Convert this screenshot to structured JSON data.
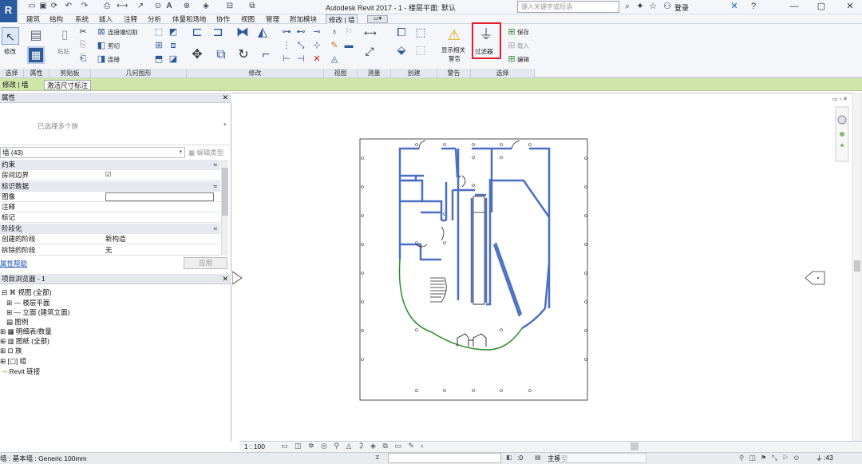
{
  "app": {
    "title": "Autodesk Revit 2017 -   1 - 楼层平面: 默认",
    "logo": "R",
    "search_placeholder": "键入关键字或短语",
    "login_label": "登录"
  },
  "tabs": [
    "建筑",
    "结构",
    "系统",
    "插入",
    "注释",
    "分析",
    "体量和场地",
    "协作",
    "视图",
    "管理",
    "附加模块",
    "修改 | 墙"
  ],
  "ribbon": {
    "modify_label": "修改",
    "paste_label": "粘贴",
    "connect_cut_label": "连接端切割",
    "cut_label": "剪切",
    "join_label": "连接",
    "display_warnings_label1": "显示相关",
    "display_warnings_label2": "警告",
    "filter_label": "过滤器",
    "save_label": "保存",
    "load_label": "载入",
    "edit_label": "编辑",
    "panels": [
      "选择",
      "属性",
      "剪贴板",
      "几何图形",
      "修改",
      "视图",
      "测量",
      "创建",
      "警告",
      "选择"
    ]
  },
  "context_bar": {
    "tab1": "修改 | 墙",
    "tab2": "激活尺寸标注"
  },
  "properties": {
    "title": "属性",
    "type_selector": "已选择多个族",
    "filter_label": "墙 (43)",
    "edit_type_label": "编辑类型",
    "sections": {
      "constraints": "约束",
      "identity": "标识数据",
      "phasing": "阶段化"
    },
    "rows": {
      "room_bounding": "房间边界",
      "image": "图像",
      "comments": "注释",
      "mark": "标记",
      "phase_created": "创建的阶段",
      "phase_created_value": "新构造",
      "phase_demolished": "拆除的阶段",
      "phase_demolished_value": "无"
    },
    "help_link": "属性帮助",
    "apply_button": "应用"
  },
  "browser": {
    "title": "项目浏览器 - 1",
    "items": [
      "视图 (全部)",
      "楼层平面",
      "立面 (建筑立面)",
      "图例",
      "明细表/数量",
      "图纸 (全部)",
      "族",
      "组",
      "Revit 链接"
    ]
  },
  "view_control": {
    "scale": "1 : 100"
  },
  "status": {
    "left_text": "墙 : 基本墙 : Generic 100mm",
    "coord": ":0",
    "model": "主模型",
    "filter_count": ":43"
  },
  "colors": {
    "accent_blue": "#2d5a99",
    "wall_blue": "#4a6fc4",
    "context_green": "#cfe5a9",
    "highlight_red": "#e0202a",
    "arc_green": "#2a8a2a"
  }
}
